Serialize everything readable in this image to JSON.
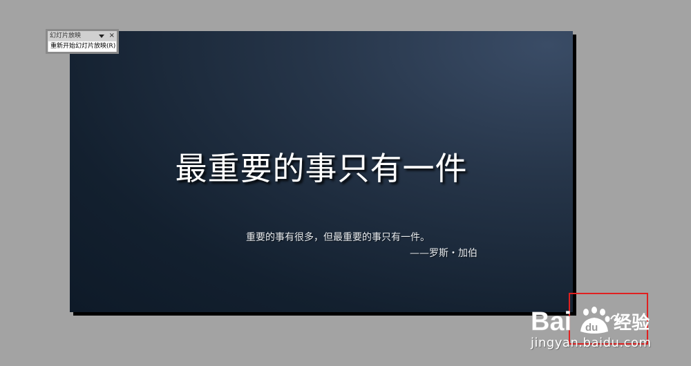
{
  "toolbar": {
    "title": "幻灯片放映",
    "close_glyph": "×",
    "menu_icon": "dropdown-arrow",
    "restart_label": "重新开始幻灯片放映(R)"
  },
  "slide": {
    "title": "最重要的事只有一件",
    "body": "重要的事有很多，但最重要的事只有一件。",
    "attribution": "——罗斯・加伯"
  },
  "watermark": {
    "brand_latin": "Bai",
    "brand_paw_letters": "du",
    "brand_cn": "经验",
    "domain": "jingyan.baidu.com",
    "highlight_color": "#e02020"
  }
}
